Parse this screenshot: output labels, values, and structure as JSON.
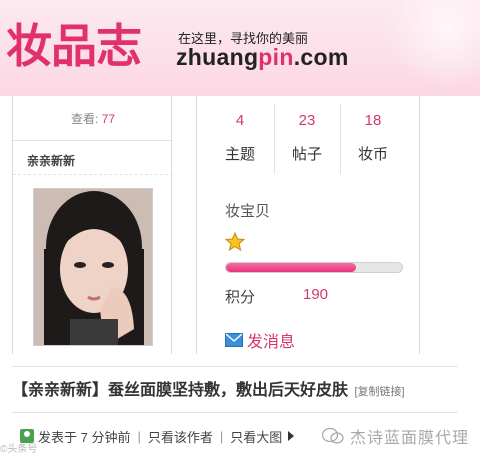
{
  "header": {
    "logo_text": "妆品志",
    "slogan": "在这里，寻找你的美丽",
    "domain_prefix": "zhuang",
    "domain_highlight": "pin",
    "domain_suffix": ".com",
    "brand_color": "#e0306d"
  },
  "profile": {
    "views_label": "查看:",
    "views_count": "77",
    "username": "亲亲新新",
    "avatar_icon": "user-photo"
  },
  "stats": [
    {
      "value": "4",
      "label": "主题"
    },
    {
      "value": "23",
      "label": "帖子"
    },
    {
      "value": "18",
      "label": "妆币"
    }
  ],
  "level": {
    "name": "妆宝贝",
    "star_icon": "star-icon",
    "progress": 0.74,
    "points_label": "积分",
    "points_value": "190"
  },
  "message_button": {
    "label": "发消息",
    "icon": "envelope-icon"
  },
  "post": {
    "title": "【亲亲新新】蚕丝面膜坚持敷，敷出后天好皮肤",
    "copy_link_label": "[复制链接]"
  },
  "meta": {
    "posted_label": "发表于 7 分钟前",
    "only_author_label": "只看该作者",
    "large_image_label": "只看大图"
  },
  "watermarks": {
    "left": "©头条号",
    "right": "杰诗蓝面膜代理"
  },
  "colors": {
    "accent": "#d4376f",
    "banner_bg": "#fbd7e4"
  }
}
